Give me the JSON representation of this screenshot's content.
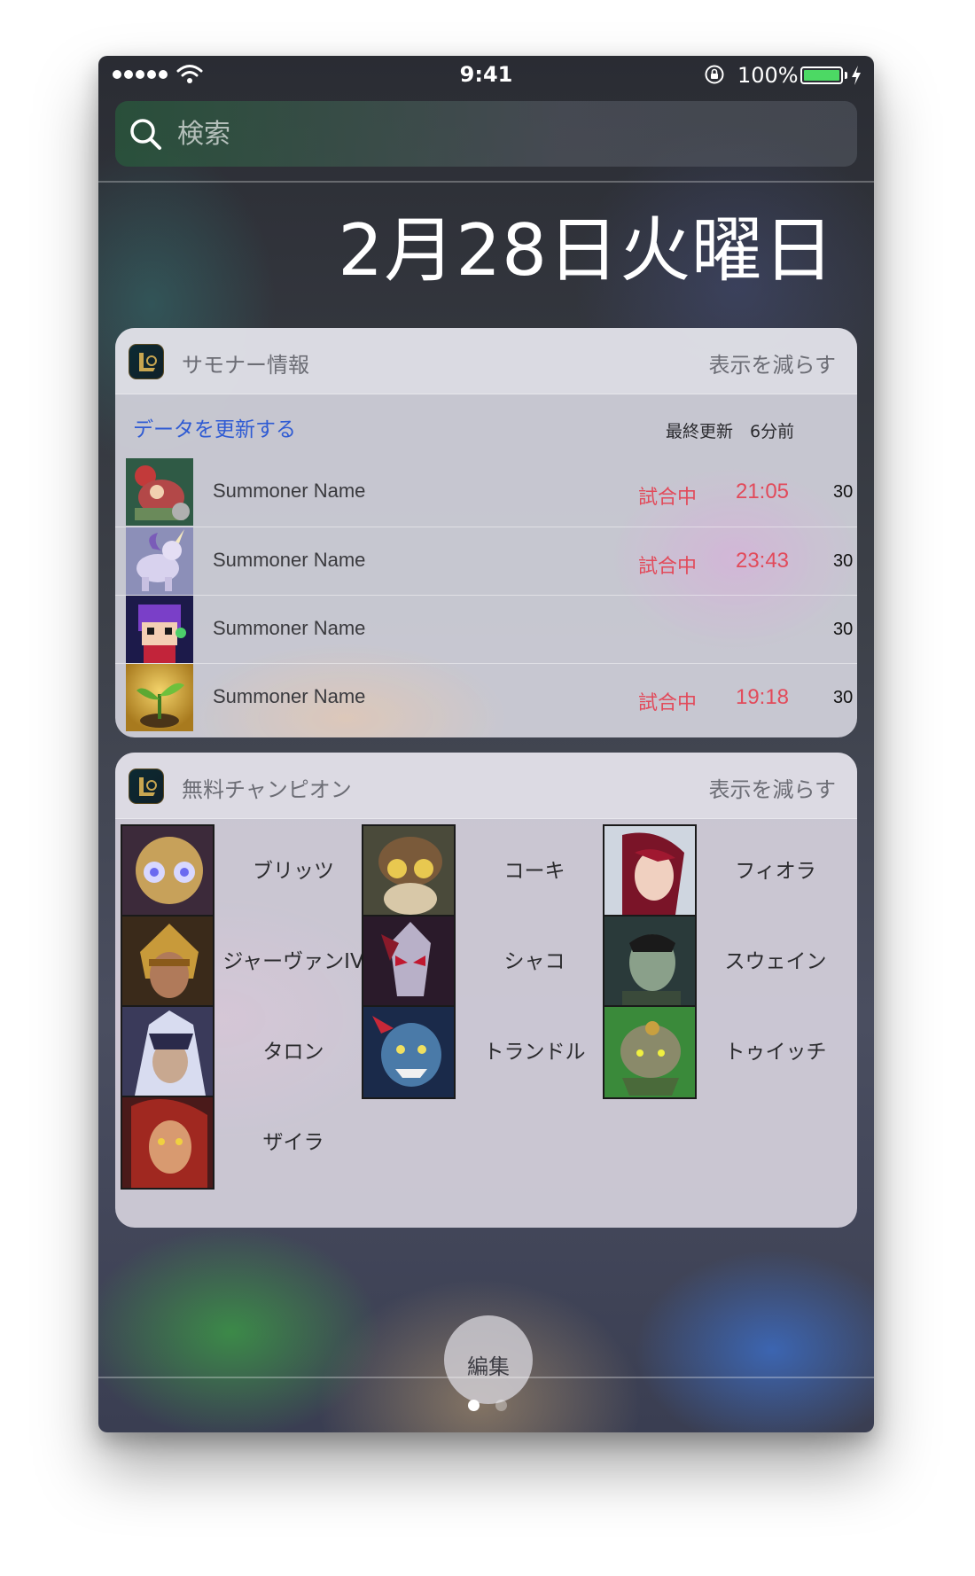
{
  "status_bar": {
    "time": "9:41",
    "battery": "100%"
  },
  "search": {
    "placeholder": "検索"
  },
  "date": "2月28日火曜日",
  "summoner_widget": {
    "title": "サモナー情報",
    "show_less": "表示を減らす",
    "refresh": "データを更新する",
    "last_updated": "最終更新　6分前",
    "rows": [
      {
        "name": "Summoner Name",
        "status": "試合中",
        "time": "21:05",
        "level": "30"
      },
      {
        "name": "Summoner Name",
        "status": "試合中",
        "time": "23:43",
        "level": "30"
      },
      {
        "name": "Summoner Name",
        "status": "",
        "time": "",
        "level": "30"
      },
      {
        "name": "Summoner Name",
        "status": "試合中",
        "time": "19:18",
        "level": "30"
      }
    ]
  },
  "champion_widget": {
    "title": "無料チャンピオン",
    "show_less": "表示を減らす",
    "champions": [
      {
        "name": "ブリッツ"
      },
      {
        "name": "コーキ"
      },
      {
        "name": "フィオラ"
      },
      {
        "name": "ジャーヴァンIV"
      },
      {
        "name": "シャコ"
      },
      {
        "name": "スウェイン"
      },
      {
        "name": "タロン"
      },
      {
        "name": "トランドル"
      },
      {
        "name": "トゥイッチ"
      },
      {
        "name": "ザイラ"
      }
    ]
  },
  "edit_button": "編集",
  "pager": {
    "pages": 2,
    "current": 1
  },
  "colors": {
    "accent_blue": "#2f5bd3",
    "in_game_red": "#e24a5a",
    "battery_green": "#4cd964"
  }
}
